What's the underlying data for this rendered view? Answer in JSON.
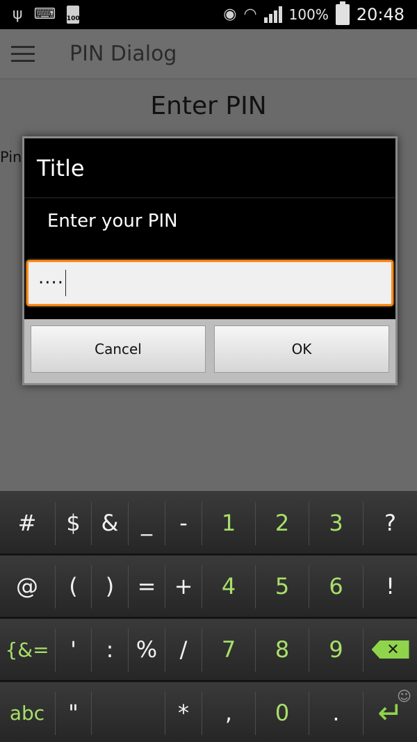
{
  "status_bar": {
    "battery_small": "100",
    "battery_percent": "100%",
    "time": "20:48"
  },
  "action_bar": {
    "title": "PIN Dialog"
  },
  "page": {
    "heading": "Enter PIN",
    "label": "Pin"
  },
  "dialog": {
    "title": "Title",
    "message": "Enter your PIN",
    "input_value": "····",
    "cancel_label": "Cancel",
    "ok_label": "OK",
    "accent": "#ff8c1a"
  },
  "keyboard": {
    "row1": [
      "#",
      "$",
      "&",
      "_",
      "-",
      "1",
      "2",
      "3",
      "?"
    ],
    "row2": [
      "@",
      "(",
      ")",
      "=",
      "+",
      "4",
      "5",
      "6",
      "!"
    ],
    "row3": [
      "{&=",
      "'",
      ":",
      "%",
      "/",
      "7",
      "8",
      "9"
    ],
    "row4": [
      "abc",
      "\"",
      "*",
      ",",
      "0",
      "."
    ],
    "accent": "#8fd44a"
  }
}
